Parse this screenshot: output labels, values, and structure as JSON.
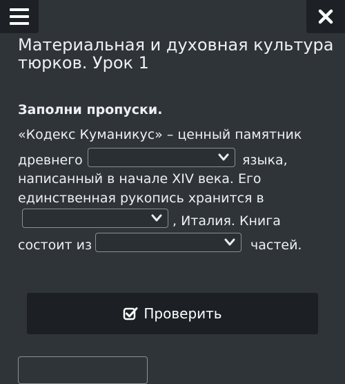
{
  "page": {
    "title": "Материальная и духовная культура тюрков. Урок 1"
  },
  "exercise": {
    "instruction": "Заполни пропуски.",
    "line1": "«Кодекс Куманикус» – ценный памятник",
    "line2_before": "древнего",
    "line2_after": "языка,",
    "line3": "написанный в начале XIV века. Его",
    "line4": "единственная рукопись хранится в",
    "line5_after": ", Италия. Книга",
    "line6_before": "состоит из",
    "line6_after": "частей.",
    "dropdowns": [
      {
        "selected": ""
      },
      {
        "selected": ""
      },
      {
        "selected": ""
      }
    ]
  },
  "buttons": {
    "check_label": "Проверить"
  },
  "icons": {
    "menu": "hamburger-menu-icon",
    "close": "close-icon",
    "check": "checkbox-check-icon",
    "dropdown": "chevron-down-icon"
  },
  "colors": {
    "background": "#2f3439",
    "header_button": "#1d2126",
    "check_button": "#1c2024",
    "text": "#eef0f2"
  }
}
